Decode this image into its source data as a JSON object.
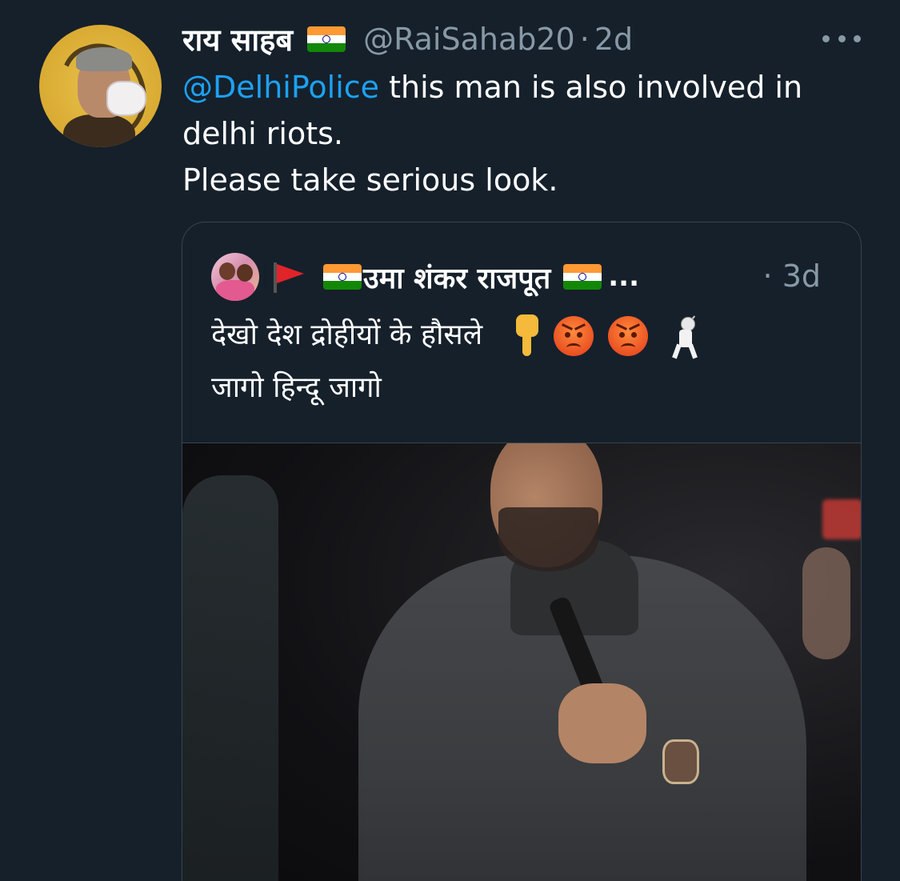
{
  "tweet": {
    "display_name": "राय साहब",
    "handle": "@RaiSahab20",
    "separator": "·",
    "time": "2d",
    "mention": "@DelhiPolice",
    "text_line1_rest": " this man is also involved in",
    "text_line2": "delhi riots.",
    "text_line3": "Please take serious look.",
    "more_icon": "more-horizontal-icon"
  },
  "quote": {
    "display_name": "उमा शंकर राजपूत",
    "ellipsis": "...",
    "time": "· 3d",
    "text_line1": "देखो देश द्रोहीयों के हौसले",
    "text_line2": "जागो हिन्दू जागो",
    "emojis": [
      "point-down-icon",
      "angry-face-icon",
      "angry-face-icon",
      "fencer-icon"
    ],
    "media_type": "video"
  },
  "colors": {
    "background": "#15202b",
    "link": "#1da1f2",
    "muted": "#8899a6",
    "border": "#38444d"
  }
}
